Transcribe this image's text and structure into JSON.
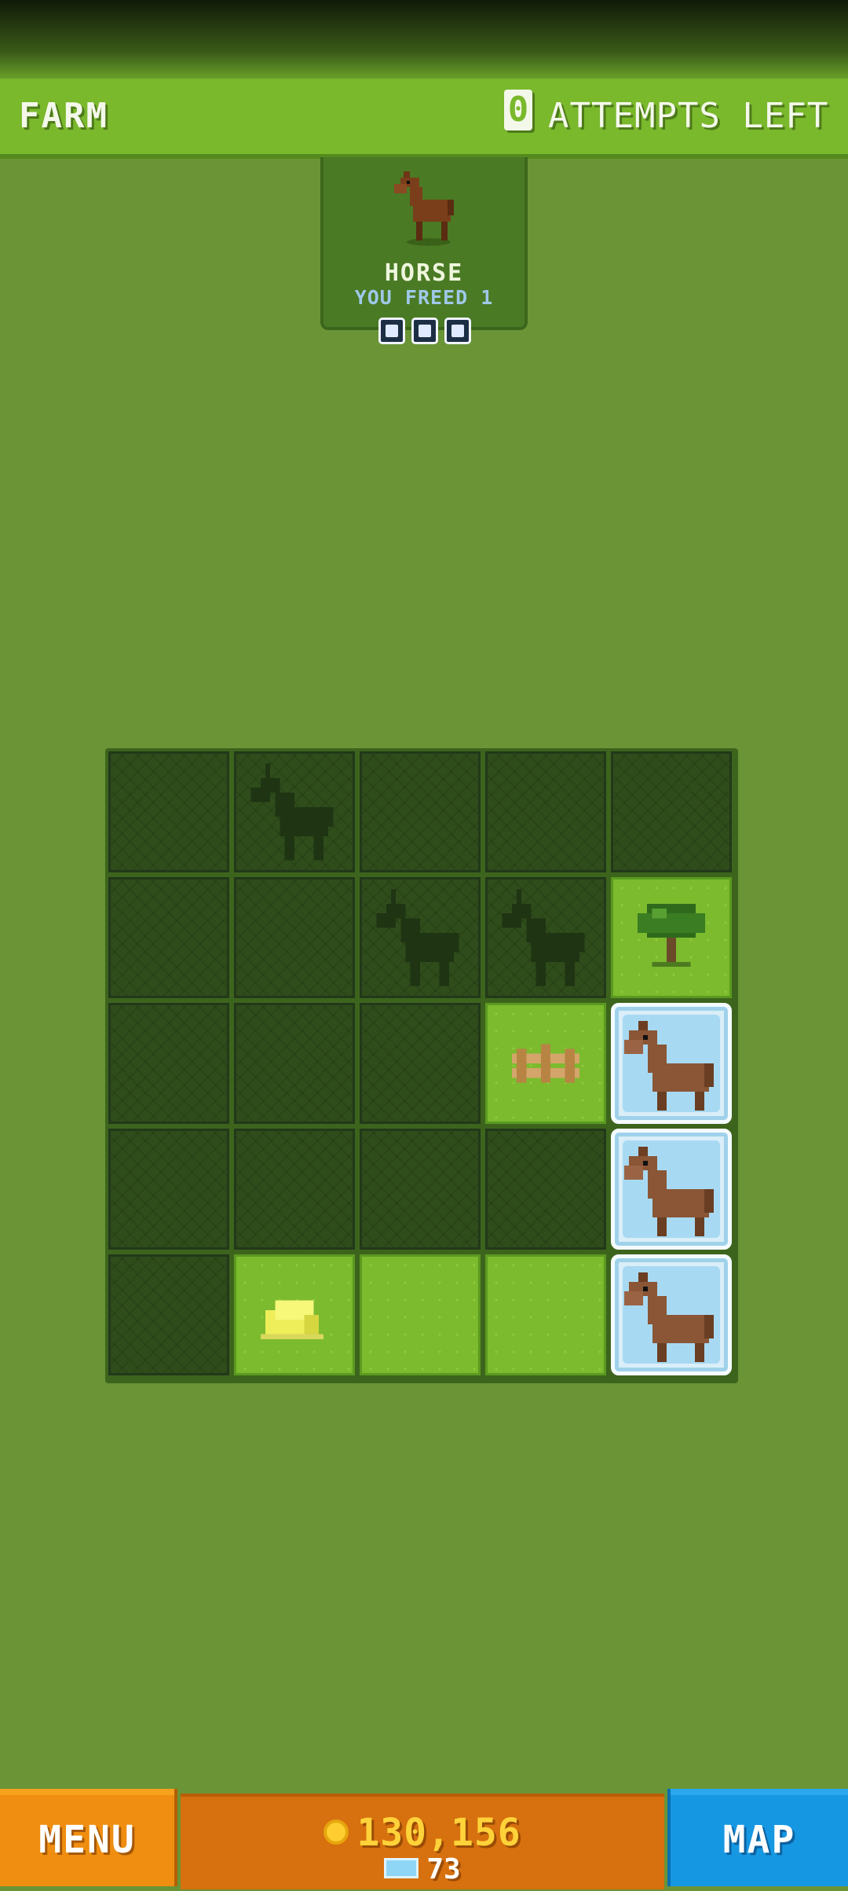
{
  "header": {
    "area_name": "FARM",
    "attempts_count": "0",
    "attempts_label": "ATTEMPTS LEFT"
  },
  "card": {
    "title": "HORSE",
    "subtitle": "YOU FREED 1",
    "progress_dots": 3
  },
  "board": {
    "rows": 5,
    "cols": 5,
    "cells": [
      [
        "dark",
        "dark-unicorn",
        "dark",
        "dark",
        "dark"
      ],
      [
        "dark",
        "dark",
        "dark-unicorn",
        "dark-unicorn",
        "light-tree"
      ],
      [
        "dark",
        "dark",
        "dark",
        "light-fence",
        "ice-horse"
      ],
      [
        "dark",
        "dark",
        "dark",
        "dark",
        "ice-horse"
      ],
      [
        "dark",
        "light-hay",
        "light",
        "light",
        "ice-horse"
      ]
    ]
  },
  "footer": {
    "menu_label": "MENU",
    "coins": "130,156",
    "gems": "73",
    "map_label": "MAP"
  },
  "colors": {
    "background": "#6a9436",
    "topbar": "#7ab82c",
    "menu_orange": "#ef8e10",
    "coin_yellow": "#ffd23a",
    "map_blue": "#1697e2"
  }
}
